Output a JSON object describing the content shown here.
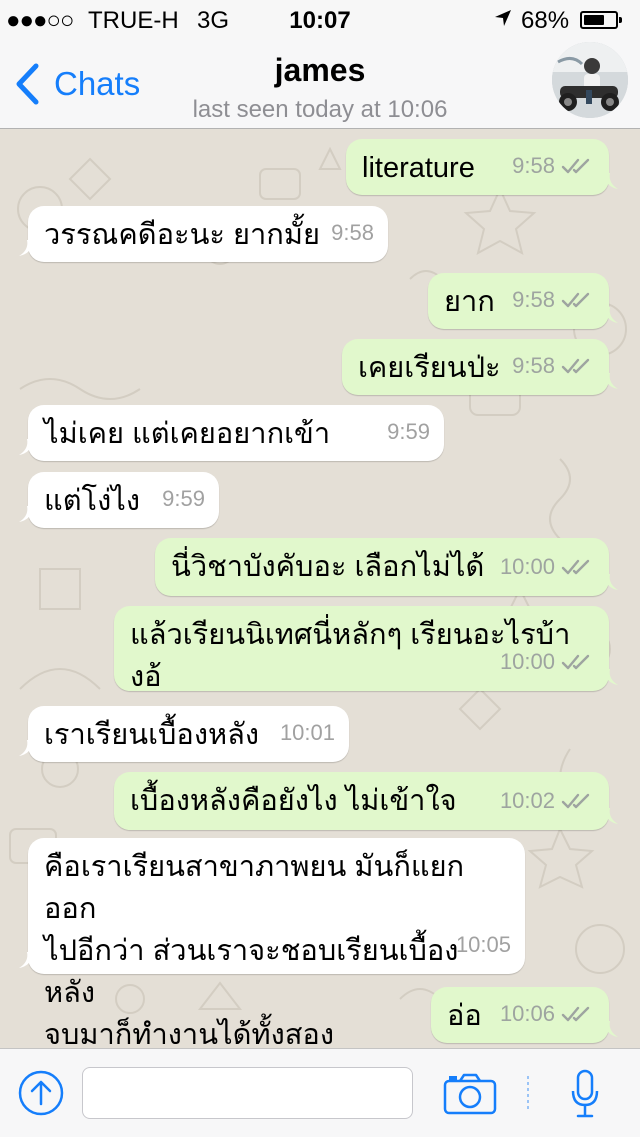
{
  "status_bar": {
    "signal": "●●●○○",
    "carrier": "TRUE-H",
    "network": "3G",
    "time": "10:07",
    "battery_percent": "68%",
    "battery_level": 0.68
  },
  "header": {
    "back_label": "Chats",
    "contact_name": "james",
    "last_seen": "last seen today at 10:06"
  },
  "messages": [
    {
      "text": "literature",
      "time": "9:58",
      "direction": "out"
    },
    {
      "text": "วรรณคดีอะนะ ยากมั้ย",
      "time": "9:58",
      "direction": "in"
    },
    {
      "text": "ยาก",
      "time": "9:58",
      "direction": "out"
    },
    {
      "text": "เคยเรียนป่ะ",
      "time": "9:58",
      "direction": "out"
    },
    {
      "text": "ไม่เคย  แต่เคยอยากเข้า",
      "time": "9:59",
      "direction": "in"
    },
    {
      "text": "แต่โง่ไง",
      "time": "9:59",
      "direction": "in"
    },
    {
      "text": "นี่วิชาบังคับอะ เลือกไม่ได้",
      "time": "10:00",
      "direction": "out"
    },
    {
      "text": "แล้วเรียนนิเทศนี่หลักๆ เรียนอะไรบ้างอ้",
      "time": "10:00",
      "direction": "out"
    },
    {
      "text": "เราเรียนเบื้องหลัง",
      "time": "10:01",
      "direction": "in"
    },
    {
      "text": "เบื้องหลังคือยังไง ไม่เข้าใจ",
      "time": "10:02",
      "direction": "out"
    },
    {
      "text": "คือเราเรียนสาขาภาพยน มันก็แยกออก\nไปอีกว่า  ส่วนเราจะชอบเรียนเบื้องหลัง\nจบมาก็ทำงานได้ทั้งสอง",
      "time": "10:05",
      "direction": "in"
    },
    {
      "text": "อ่อ",
      "time": "10:06",
      "direction": "out"
    }
  ],
  "input": {
    "value": "",
    "placeholder": ""
  },
  "icons": {
    "back": "chevron-left-icon",
    "share": "share-arrow-up-icon",
    "camera": "camera-icon",
    "mic": "microphone-icon",
    "read_receipt": "double-check-icon",
    "location": "location-arrow-icon"
  },
  "colors": {
    "accent": "#157efb",
    "outgoing_bubble": "#e1f8cc",
    "incoming_bubble": "#ffffff",
    "chat_background": "#e4dfd6",
    "tick": "#9ea4a0"
  }
}
